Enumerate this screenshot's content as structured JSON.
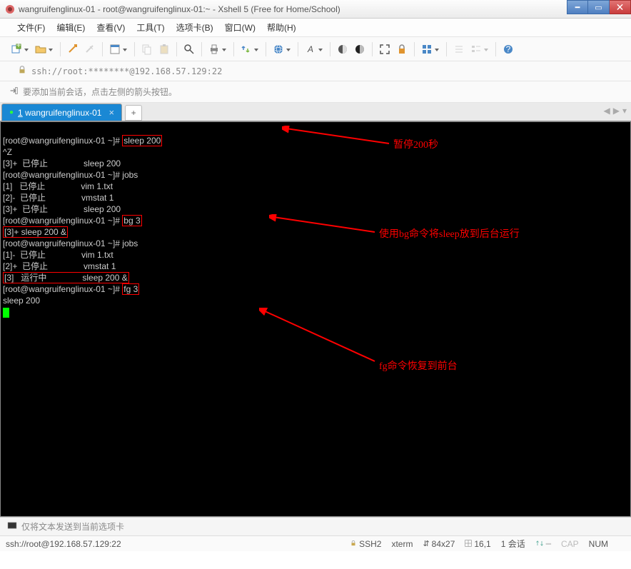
{
  "window": {
    "title": "wangruifenglinux-01 - root@wangruifenglinux-01:~ - Xshell 5 (Free for Home/School)"
  },
  "menu": {
    "file": "文件(F)",
    "edit": "编辑(E)",
    "view": "查看(V)",
    "tools": "工具(T)",
    "tabs": "选项卡(B)",
    "window": "窗口(W)",
    "help": "帮助(H)"
  },
  "address": {
    "text": "ssh://root:********@192.168.57.129:22"
  },
  "hint": {
    "text": "要添加当前会话，点击左侧的箭头按钮。"
  },
  "tab": {
    "index": "1",
    "label": "wangruifenglinux-01"
  },
  "terminal": {
    "line1_prompt": "[root@wangruifenglinux-01 ~]# ",
    "line1_cmd": "sleep 200",
    "line2": "^Z",
    "line3": "[3]+  已停止               sleep 200",
    "line4_prompt": "[root@wangruifenglinux-01 ~]# ",
    "line4_cmd": "jobs",
    "line5": "[1]   已停止               vim 1.txt",
    "line6": "[2]-  已停止               vmstat 1",
    "line7": "[3]+  已停止               sleep 200",
    "line8_prompt": "[root@wangruifenglinux-01 ~]# ",
    "line8_cmd": "bg 3",
    "line9": "[3]+ sleep 200 &",
    "line10_prompt": "[root@wangruifenglinux-01 ~]# ",
    "line10_cmd": "jobs",
    "line11": "[1]-  已停止               vim 1.txt",
    "line12": "[2]+  已停止               vmstat 1",
    "line13": "[3]   运行中               sleep 200 &",
    "line14_prompt": "[root@wangruifenglinux-01 ~]# ",
    "line14_cmd": "fg 3",
    "line15": "sleep 200"
  },
  "annotations": {
    "a1": "暂停200秒",
    "a2": "使用bg命令将sleep放到后台运行",
    "a3": "fg命令恢复到前台"
  },
  "input": {
    "placeholder": "仅将文本发送到当前选项卡"
  },
  "status": {
    "conn": "ssh://root@192.168.57.129:22",
    "ssh": "SSH2",
    "term": "xterm",
    "size": "84x27",
    "pos": "16,1",
    "session": "1 会话",
    "caps": "CAP",
    "num": "NUM"
  },
  "icons": {
    "lock": "lock-icon",
    "new": "new-session-icon",
    "open": "open-folder-icon"
  }
}
